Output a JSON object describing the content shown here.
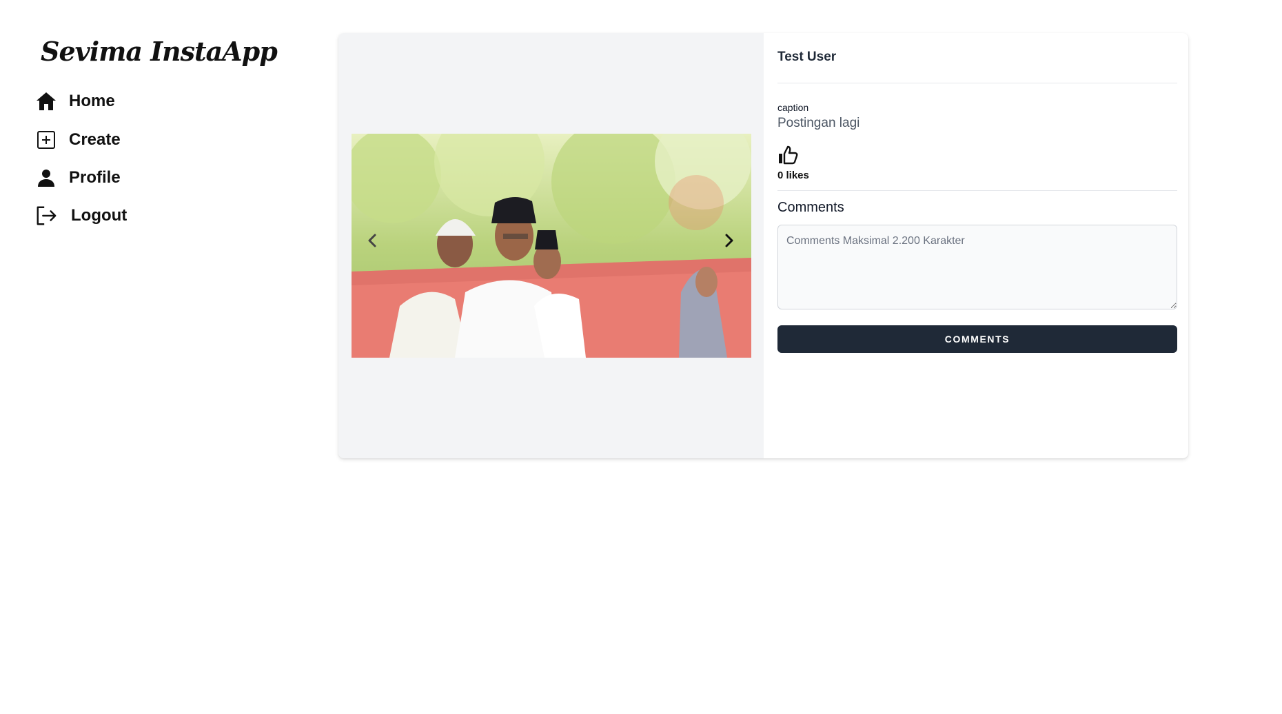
{
  "app": {
    "logo": "Sevima InstaApp"
  },
  "sidebar": {
    "items": [
      {
        "label": "Home",
        "icon": "home-icon"
      },
      {
        "label": "Create",
        "icon": "plus-square-icon"
      },
      {
        "label": "Profile",
        "icon": "person-icon"
      },
      {
        "label": "Logout",
        "icon": "logout-icon"
      }
    ]
  },
  "post": {
    "username": "Test User",
    "caption_label": "caption",
    "caption": "Postingan lagi",
    "likes": "0 likes",
    "comments_title": "Comments",
    "comment_placeholder": "Comments Maksimal 2.200 Karakter",
    "comment_button": "COMMENTS"
  },
  "colors": {
    "button_bg": "#1f2937",
    "media_bg": "#f3f4f6"
  }
}
